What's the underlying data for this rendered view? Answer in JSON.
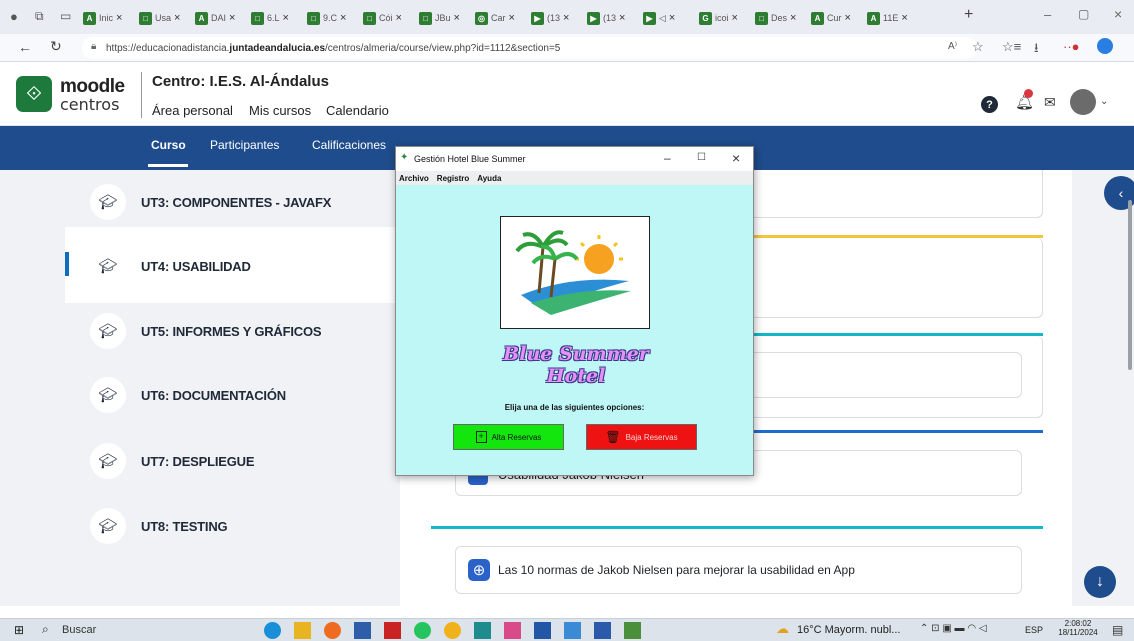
{
  "browser": {
    "tabs": [
      {
        "icon": "A",
        "label": "Inic"
      },
      {
        "icon": "□",
        "label": "Usa"
      },
      {
        "icon": "A",
        "label": "DAI"
      },
      {
        "icon": "□",
        "label": "6.L"
      },
      {
        "icon": "□",
        "label": "9.C"
      },
      {
        "icon": "□",
        "label": "Cói"
      },
      {
        "icon": "□",
        "label": "JBu"
      },
      {
        "icon": "◎",
        "label": "Car"
      },
      {
        "icon": "▶",
        "label": "(13"
      },
      {
        "icon": "▶",
        "label": "(13"
      },
      {
        "icon": "▶",
        "label": "◁"
      },
      {
        "icon": "G",
        "label": "icoi"
      },
      {
        "icon": "□",
        "label": "Des"
      },
      {
        "icon": "A",
        "label": "Cur"
      },
      {
        "icon": "A",
        "label": "11E"
      }
    ],
    "url_prefix": "https://educacionadistancia.",
    "url_domain": "juntadeandalucia.es",
    "url_path": "/centros/almeria/course/view.php?id=1112&section=5"
  },
  "moodle": {
    "brand_top": "moodle",
    "brand_bottom": "centros",
    "centro": "Centro: I.E.S. Al-Ándalus",
    "links": [
      "Área personal",
      "Mis cursos",
      "Calendario"
    ],
    "nav": [
      "Curso",
      "Participantes",
      "Calificaciones"
    ],
    "units": [
      "UT3: COMPONENTES - JAVAFX",
      "UT4: USABILIDAD",
      "UT5: INFORMES Y GRÁFICOS",
      "UT6: DOCUMENTACIÓN",
      "UT7: DESPLIEGUE",
      "UT8: TESTING"
    ],
    "active_unit": "UT4: USABILIDAD",
    "partial_resource": "Usabilidad Jakob Nielsen",
    "resource": "Las 10 normas de Jakob Nielsen para mejorar la usabilidad en App"
  },
  "dialog": {
    "title": "Gestión Hotel Blue Summer",
    "menu": [
      "Archivo",
      "Registro",
      "Ayuda"
    ],
    "hotel_name": "Blue Summer Hotel",
    "prompt": "Elija una de las siguientes opciones:",
    "btn_alta": "Alta Reservas",
    "btn_baja": "Baja Reservas",
    "colors": {
      "bg": "#bff7f6",
      "alta": "#13e60c",
      "baja": "#ef1212"
    }
  },
  "taskbar": {
    "search": "Buscar",
    "weather": "16°C  Mayorm. nubl...",
    "lang": "ESP",
    "time": "2:08:02",
    "date": "18/11/2024"
  }
}
